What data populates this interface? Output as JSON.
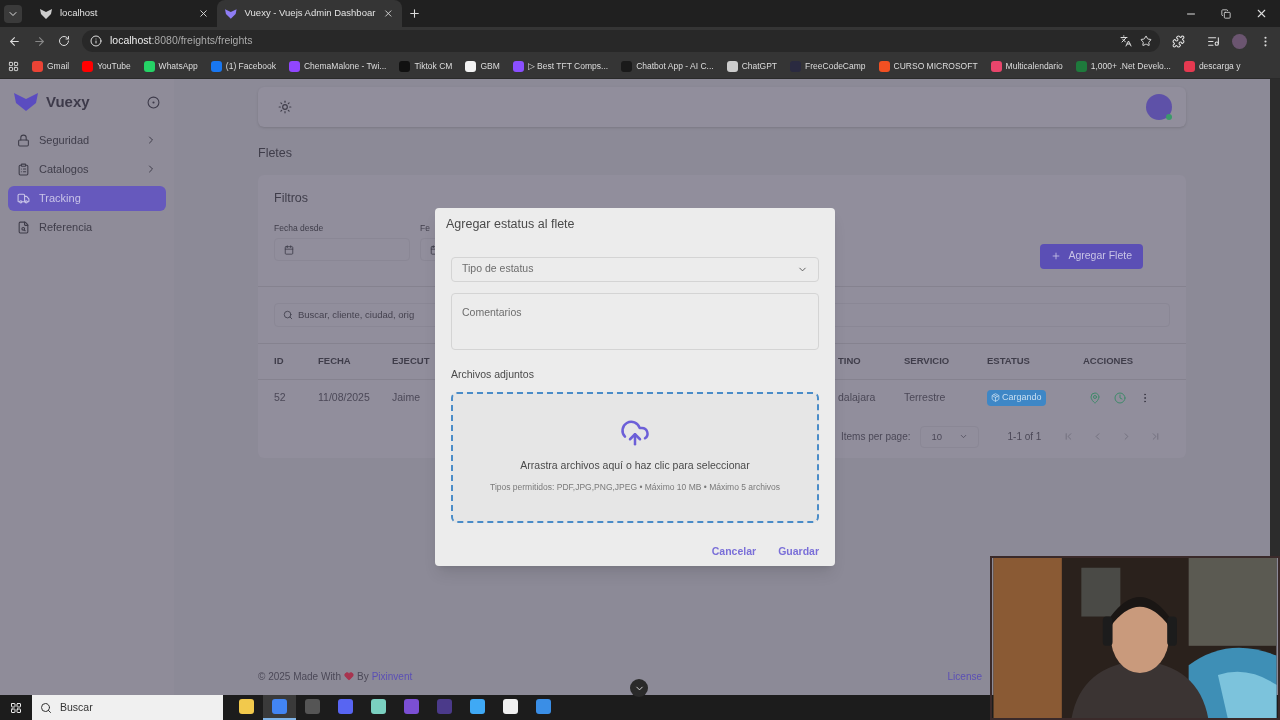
{
  "browser": {
    "tabs": [
      {
        "title": "localhost",
        "selected": false
      },
      {
        "title": "Vuexy - Vuejs Admin Dashboar",
        "selected": true
      }
    ],
    "url_host": "localhost",
    "url_rest": ":8080/freights/freights",
    "bookmarks": [
      {
        "label": "Gmail",
        "color": "#ea4335"
      },
      {
        "label": "YouTube",
        "color": "#ff0000"
      },
      {
        "label": "WhatsApp",
        "color": "#25d366"
      },
      {
        "label": "(1) Facebook",
        "color": "#1877f2"
      },
      {
        "label": "ChemaMalone - Twi...",
        "color": "#9146ff"
      },
      {
        "label": "Tiktok CM",
        "color": "#111111"
      },
      {
        "label": "GBM",
        "color": "#f2f2f2"
      },
      {
        "label": "▷ Best TFT Comps...",
        "color": "#8a4fff"
      },
      {
        "label": "Chatbot App - AI C...",
        "color": "#1a1a1a"
      },
      {
        "label": "ChatGPT",
        "color": "#cccccc"
      },
      {
        "label": "FreeCodeCamp",
        "color": "#2a2a40"
      },
      {
        "label": "CURSO MICROSOFT",
        "color": "#f25022"
      },
      {
        "label": "Multicalendario",
        "color": "#e8456b"
      },
      {
        "label": "1,000+ .Net Develo...",
        "color": "#1e7a3c"
      },
      {
        "label": "descarga y",
        "color": "#e53950"
      }
    ]
  },
  "sidebar": {
    "brand": "Vuexy",
    "items": [
      {
        "label": "Seguridad",
        "selected": false,
        "has_children": true
      },
      {
        "label": "Catalogos",
        "selected": false,
        "has_children": true
      },
      {
        "label": "Tracking",
        "selected": true,
        "has_children": false
      },
      {
        "label": "Referencia",
        "selected": false,
        "has_children": false
      }
    ]
  },
  "page": {
    "title": "Fletes",
    "filters_title": "Filtros",
    "filter_labels": [
      "Fecha desde",
      "Fe"
    ],
    "add_button": "Agregar Flete",
    "search_placeholder": "Buscar, cliente, ciudad, orig",
    "table": {
      "columns": [
        {
          "label": "ID",
          "kind": "text"
        },
        {
          "label": "FECHA",
          "kind": "text"
        },
        {
          "label": "EJECUT",
          "kind": "text"
        },
        {
          "label": "TINO",
          "kind": "text"
        },
        {
          "label": "SERVICIO",
          "kind": "text"
        },
        {
          "label": "ESTATUS",
          "kind": "badge"
        },
        {
          "label": "ACCIONES",
          "kind": "actions"
        }
      ],
      "rows": [
        {
          "cells": [
            "52",
            "11/08/2025",
            "Jaime",
            "dalajara",
            "Terrestre",
            "Cargando"
          ]
        }
      ]
    },
    "pagination": {
      "label": "Items per page:",
      "per_page": "10",
      "range": "1-1 of 1"
    }
  },
  "footer": {
    "text": "© 2025 Made With",
    "by": "By",
    "link": "Pixinvent",
    "license": "License"
  },
  "dialog": {
    "title": "Agregar estatus al flete",
    "select_placeholder": "Tipo de estatus",
    "comments_placeholder": "Comentarios",
    "attachments_label": "Archivos adjuntos",
    "drop_text": "Arrastra archivos aquí o haz clic para seleccionar",
    "drop_hint": "Tipos permitidos: PDF,JPG,PNG,JPEG • Máximo 10 MB • Máximo 5 archivos",
    "buttons": [
      "Cancelar",
      "Guardar"
    ]
  },
  "taskbar": {
    "search_placeholder": "Buscar",
    "apps": [
      {
        "color": "#f2c94c",
        "selected": false
      },
      {
        "color": "#4285f4",
        "selected": true
      },
      {
        "color": "#555555",
        "selected": false
      },
      {
        "color": "#5865f2",
        "selected": false
      },
      {
        "color": "#7ad0c0",
        "selected": false
      },
      {
        "color": "#7b4fd4",
        "selected": false
      },
      {
        "color": "#4b3a8a",
        "selected": false
      },
      {
        "color": "#3fa9f5",
        "selected": false
      },
      {
        "color": "#f0f0f0",
        "selected": false
      },
      {
        "color": "#3a8ee6",
        "selected": false
      }
    ]
  }
}
